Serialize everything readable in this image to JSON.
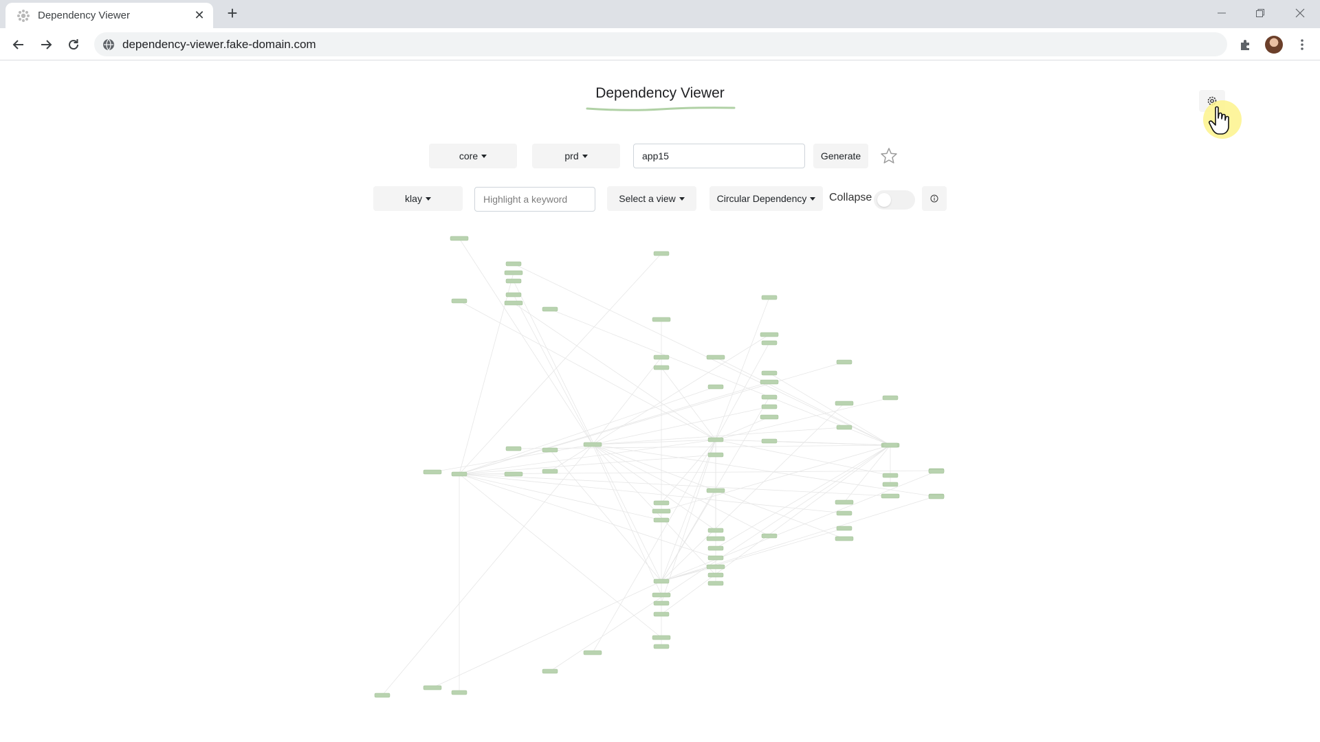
{
  "browser": {
    "tab_title": "Dependency Viewer",
    "new_tab_label": "+",
    "url": "dependency-viewer.fake-domain.com"
  },
  "page": {
    "title": "Dependency Viewer",
    "accent_color": "#8fbf80"
  },
  "controls": {
    "namespace_dropdown": "core",
    "environment_dropdown": "prd",
    "app_input_value": "app15",
    "generate_label": "Generate",
    "user_dropdown": "klay",
    "highlight_placeholder": "Highlight a keyword",
    "view_dropdown": "Select a view",
    "mode_dropdown": "Circular Dependency",
    "collapse_label": "Collapse",
    "collapse_enabled": false
  },
  "graph": {
    "node_color": "#b9d3b0",
    "node_count": 92
  }
}
